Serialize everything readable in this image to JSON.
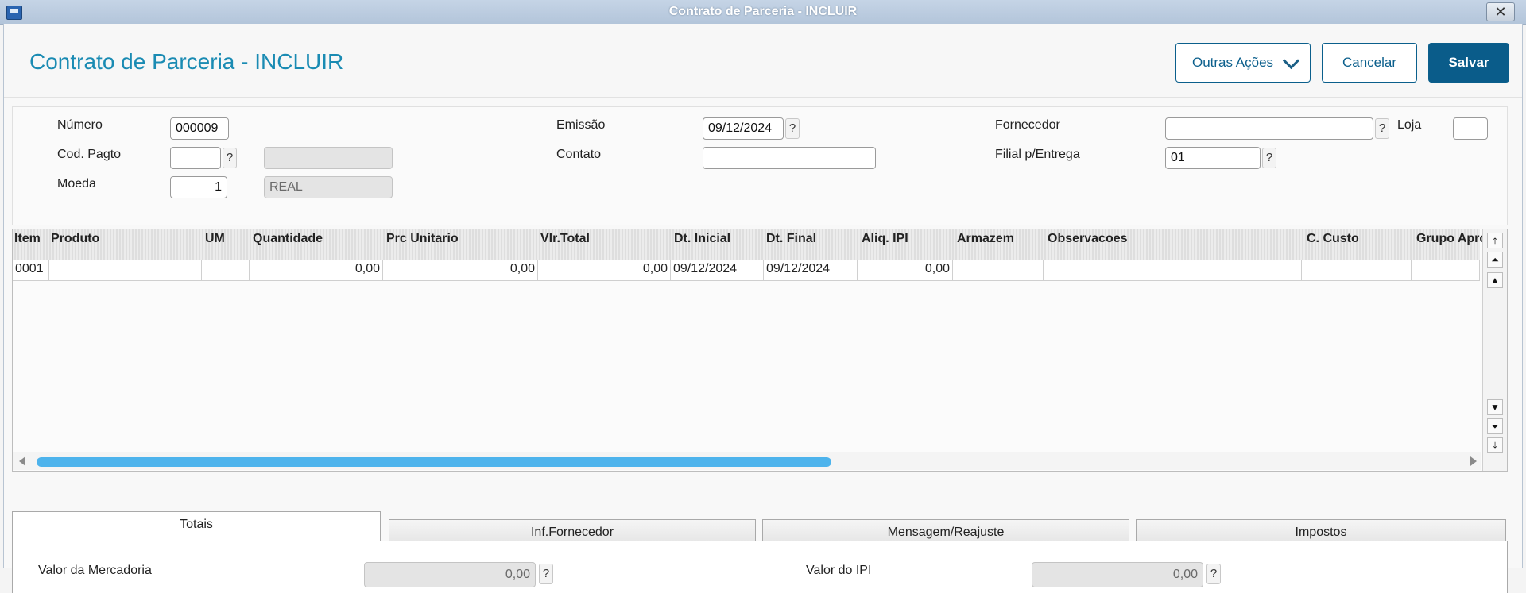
{
  "window": {
    "title": "Contrato de Parceria - INCLUIR",
    "close_glyph": "✕"
  },
  "header": {
    "title": "Contrato de Parceria - INCLUIR",
    "actions": {
      "more_label": "Outras Ações",
      "cancel_label": "Cancelar",
      "save_label": "Salvar"
    }
  },
  "form": {
    "numero": {
      "label": "Número",
      "value": "000009"
    },
    "emissao": {
      "label": "Emissão",
      "value": "09/12/2024"
    },
    "fornecedor": {
      "label": "Fornecedor",
      "value": ""
    },
    "loja": {
      "label": "Loja",
      "value": ""
    },
    "cod_pagto": {
      "label": "Cod. Pagto",
      "value": "",
      "description": ""
    },
    "contato": {
      "label": "Contato",
      "value": ""
    },
    "filial": {
      "label": "Filial p/Entrega",
      "value": "01"
    },
    "moeda": {
      "label": "Moeda",
      "value": "1",
      "description": "REAL"
    },
    "help_glyph": "?"
  },
  "grid": {
    "columns": [
      "Item",
      "Produto",
      "UM",
      "Quantidade",
      "Prc Unitario",
      "Vlr.Total",
      "Dt. Inicial",
      "Dt. Final",
      "Aliq. IPI",
      "Armazem",
      "Observacoes",
      "C. Custo",
      "Grupo Apro"
    ],
    "rows": [
      [
        "0001",
        "",
        "",
        "0,00",
        "0,00",
        "0,00",
        "09/12/2024",
        "09/12/2024",
        "0,00",
        "",
        "",
        "",
        ""
      ]
    ]
  },
  "tabs": [
    {
      "label": "Totais",
      "active": true
    },
    {
      "label": "Inf.Fornecedor",
      "active": false
    },
    {
      "label": "Mensagem/Reajuste",
      "active": false
    },
    {
      "label": "Impostos",
      "active": false
    }
  ],
  "totais": {
    "valor_mercadoria": {
      "label": "Valor da Mercadoria",
      "value": "0,00"
    },
    "valor_ipi": {
      "label": "Valor do IPI",
      "value": "0,00"
    }
  },
  "colors": {
    "accent": "#1a8bb3",
    "primary_button": "#0a5c8a",
    "scroll_thumb": "#4db3ec"
  }
}
